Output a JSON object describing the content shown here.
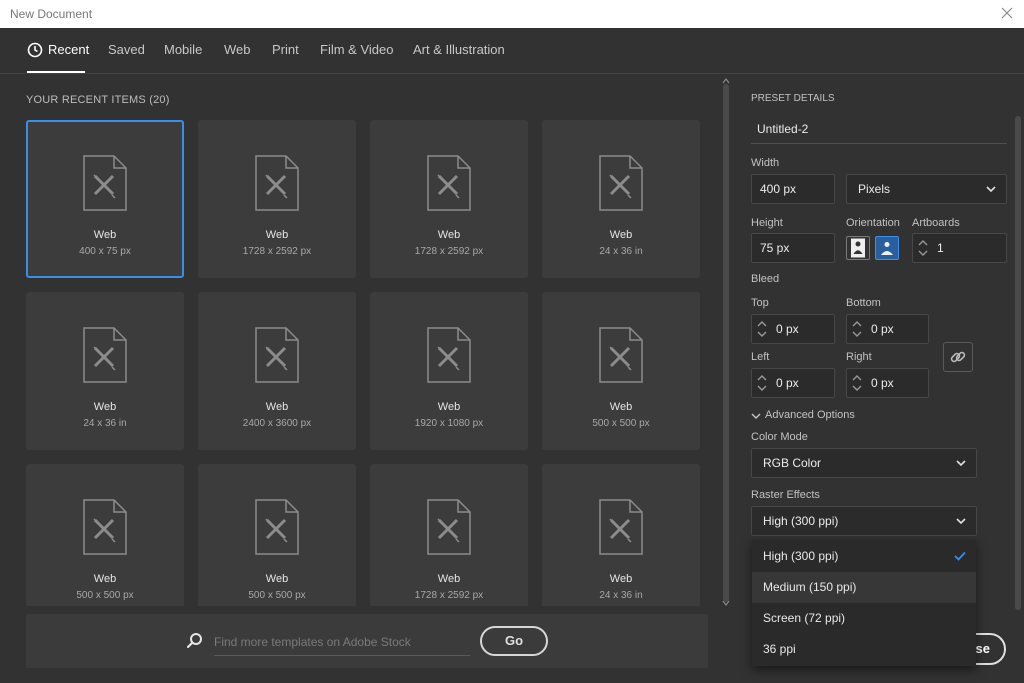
{
  "window": {
    "title": "New Document"
  },
  "tabs": [
    {
      "label": "Recent",
      "active": true
    },
    {
      "label": "Saved"
    },
    {
      "label": "Mobile"
    },
    {
      "label": "Web"
    },
    {
      "label": "Print"
    },
    {
      "label": "Film & Video"
    },
    {
      "label": "Art & Illustration"
    }
  ],
  "recent": {
    "header": "YOUR RECENT ITEMS",
    "count": "(20)",
    "items": [
      {
        "type": "Web",
        "size": "400 x 75 px",
        "selected": true
      },
      {
        "type": "Web",
        "size": "1728 x 2592 px"
      },
      {
        "type": "Web",
        "size": "1728 x 2592 px"
      },
      {
        "type": "Web",
        "size": "24 x 36 in"
      },
      {
        "type": "Web",
        "size": "24 x 36 in"
      },
      {
        "type": "Web",
        "size": "2400 x 3600 px"
      },
      {
        "type": "Web",
        "size": "1920 x 1080 px"
      },
      {
        "type": "Web",
        "size": "500 x 500 px"
      },
      {
        "type": "Web",
        "size": "500 x 500 px"
      },
      {
        "type": "Web",
        "size": "500 x 500 px"
      },
      {
        "type": "Web",
        "size": "1728 x 2592 px"
      },
      {
        "type": "Web",
        "size": "24 x 36 in"
      }
    ]
  },
  "search": {
    "placeholder": "Find more templates on Adobe Stock",
    "button_label": "Go"
  },
  "preset": {
    "header": "PRESET DETAILS",
    "name": "Untitled-2",
    "width_label": "Width",
    "width_value": "400 px",
    "units": "Pixels",
    "height_label": "Height",
    "height_value": "75 px",
    "orientation_label": "Orientation",
    "artboards_label": "Artboards",
    "artboards_value": "1",
    "bleed_label": "Bleed",
    "top_label": "Top",
    "top_value": "0 px",
    "bottom_label": "Bottom",
    "bottom_value": "0 px",
    "left_label": "Left",
    "left_value": "0 px",
    "right_label": "Right",
    "right_value": "0 px",
    "advanced_label": "Advanced Options",
    "color_mode_label": "Color Mode",
    "color_mode_value": "RGB Color",
    "raster_label": "Raster Effects",
    "raster_value": "High (300 ppi)",
    "raster_options": [
      "High (300 ppi)",
      "Medium (150 ppi)",
      "Screen (72 ppi)",
      "36 ppi"
    ],
    "close_partial": "se"
  },
  "colors": {
    "accent": "#3b8ee8",
    "background": "#323232",
    "tile": "#3c3c3c"
  },
  "icons": [
    "clock-icon",
    "document-template-icon",
    "search-icon",
    "chevron-down-icon",
    "link-icon",
    "checkmark-icon",
    "close-icon",
    "portrait-icon",
    "landscape-icon"
  ]
}
